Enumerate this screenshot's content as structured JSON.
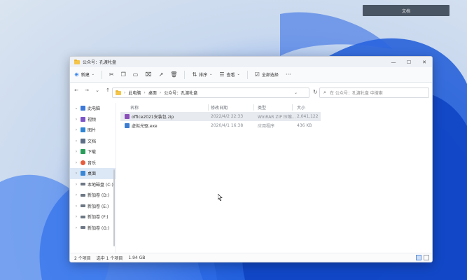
{
  "overlay_chip": "文档",
  "window": {
    "title": "公众号：孔渡牝盘",
    "controls": {
      "minimize": "—",
      "maximize": "☐",
      "close": "✕"
    }
  },
  "toolbar": {
    "new_label": "新建",
    "sort_label": "排序",
    "view_label": "查看",
    "select_all_label": "全部选择",
    "more_label": "···"
  },
  "address": {
    "crumbs": [
      "此电脑",
      "桌面",
      "公众号：孔渡牝盘"
    ]
  },
  "search": {
    "placeholder": "在 公众号：孔渡牝盘 中搜索"
  },
  "sidebar": {
    "items": [
      {
        "label": "此电脑",
        "caret": "⌄",
        "color": "#3b78d8"
      },
      {
        "label": "视频",
        "caret": "›",
        "color": "#7d55c7"
      },
      {
        "label": "图片",
        "caret": "›",
        "color": "#2f86d6"
      },
      {
        "label": "文档",
        "caret": "›",
        "color": "#5d6f86"
      },
      {
        "label": "下载",
        "caret": "›",
        "color": "#2a9d5b"
      },
      {
        "label": "音乐",
        "caret": "›",
        "color": "#e55b3c"
      },
      {
        "label": "桌面",
        "caret": "›",
        "color": "#3a86d6"
      },
      {
        "label": "本地磁盘 (C:)",
        "caret": "›",
        "color": "#6d7785"
      },
      {
        "label": "新加卷 (D:)",
        "caret": "›",
        "color": "#6d7785"
      },
      {
        "label": "新加卷 (E:)",
        "caret": "›",
        "color": "#6d7785"
      },
      {
        "label": "新加卷 (F:)",
        "caret": "›",
        "color": "#6d7785"
      },
      {
        "label": "新加卷 (G:)",
        "caret": "›",
        "color": "#6d7785"
      }
    ],
    "selected_index": 6
  },
  "table": {
    "headers": [
      "名称",
      "修改日期",
      "类型",
      "大小"
    ],
    "rows": [
      {
        "name": "office2021安装包.zip",
        "date": "2022/4/2 22:33",
        "type": "WinRAR ZIP 压缩...",
        "size": "2,041,122",
        "icon_color": "#8a4fb8"
      },
      {
        "name": "虚拟光驱.exe",
        "date": "2020/4/1 16:38",
        "type": "应用程序",
        "size": "436 KB",
        "icon_color": "#3c7dd1"
      }
    ]
  },
  "statusbar": {
    "count": "2 个项目",
    "selected": "选中 1 个项目",
    "size": "1.94 GB"
  },
  "colors": {
    "accent": "#1a73e8",
    "selection": "#dde8f6"
  }
}
